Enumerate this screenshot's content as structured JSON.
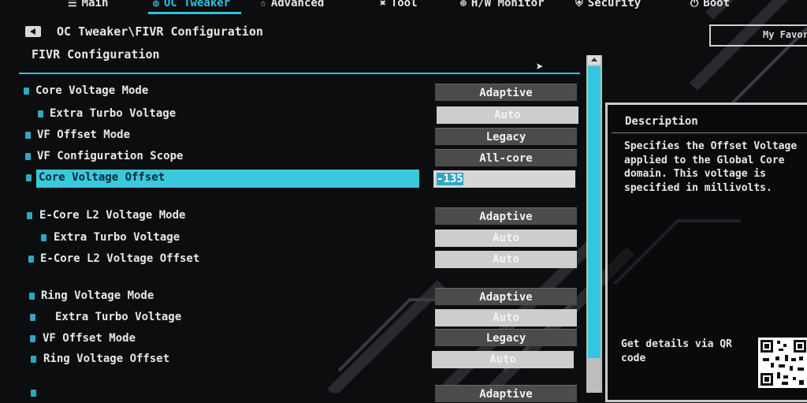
{
  "nav": {
    "tabs": [
      {
        "label": "Main",
        "icon": "list-icon"
      },
      {
        "label": "OC Tweaker",
        "icon": "gauge-icon",
        "active": true
      },
      {
        "label": "Advanced",
        "icon": "star-icon"
      },
      {
        "label": "Tool",
        "icon": "tools-icon"
      },
      {
        "label": "H/W Monitor",
        "icon": "monitor-icon"
      },
      {
        "label": "Security",
        "icon": "shield-icon"
      },
      {
        "label": "Boot",
        "icon": "power-icon"
      }
    ],
    "favorites": "My Favor"
  },
  "breadcrumb": "OC Tweaker\\FIVR Configuration",
  "section_title": "FIVR Configuration",
  "settings": [
    {
      "label": "Core Voltage Mode",
      "value": "Adaptive"
    },
    {
      "label": "Extra Turbo Voltage",
      "value": "Auto"
    },
    {
      "label": "VF Offset Mode",
      "value": "Legacy"
    },
    {
      "label": "VF Configuration Scope",
      "value": "All-core"
    },
    {
      "label": "Core Voltage Offset",
      "value": "-135"
    },
    {
      "label": "E-Core L2 Voltage Mode",
      "value": "Adaptive"
    },
    {
      "label": "Extra Turbo Voltage",
      "value": "Auto"
    },
    {
      "label": "E-Core L2 Voltage Offset",
      "value": "Auto"
    },
    {
      "label": "Ring Voltage Mode",
      "value": "Adaptive"
    },
    {
      "label": "Extra Turbo Voltage",
      "value": "Auto"
    },
    {
      "label": "VF Offset Mode",
      "value": "Legacy"
    },
    {
      "label": "Ring Voltage Offset",
      "value": "Auto"
    },
    {
      "label": "",
      "value": "Adaptive"
    }
  ],
  "description": {
    "title": "Description",
    "text": "Specifies the Offset Voltage\napplied to the Global Core\ndomain. This voltage is\nspecified in millivolts.",
    "qr_text": "Get details via QR\ncode"
  },
  "colors": {
    "accent": "#2fc2da",
    "background": "#0c0d0f"
  }
}
